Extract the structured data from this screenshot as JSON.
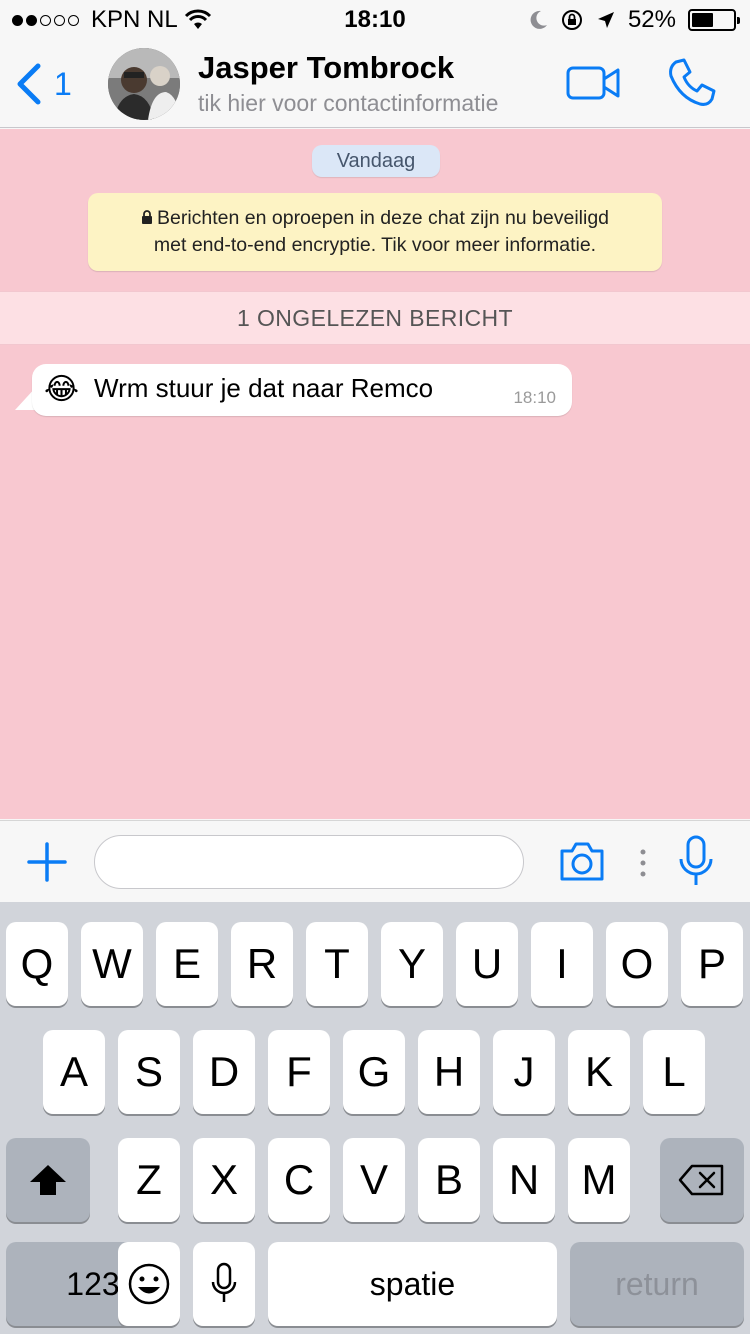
{
  "status_bar": {
    "carrier": "KPN NL",
    "time": "18:10",
    "battery_percent": "52%",
    "battery_level": 0.52,
    "signal_bars": 2,
    "icons": [
      "wifi-icon",
      "moon-icon",
      "orientation-lock-icon",
      "location-icon"
    ]
  },
  "header": {
    "back_count": "1",
    "contact_name": "Jasper Tombrock",
    "contact_subtitle": "tik hier voor contactinformatie",
    "accent_color": "#0a7cf5"
  },
  "chat": {
    "background_color": "#f8c8d0",
    "date_label": "Vandaag",
    "encryption_line1": "Berichten en oproepen in deze chat zijn nu beveiligd",
    "encryption_line2": "met end-to-end encryptie. Tik voor meer informatie.",
    "unread_label": "1 ONGELEZEN BERICHT",
    "messages": [
      {
        "emoji": "😂",
        "text": "Wrm stuur je dat naar Remco",
        "time": "18:10",
        "direction": "incoming"
      }
    ]
  },
  "input": {
    "value": "",
    "placeholder": ""
  },
  "keyboard": {
    "row1": [
      "Q",
      "W",
      "E",
      "R",
      "T",
      "Y",
      "U",
      "I",
      "O",
      "P"
    ],
    "row2": [
      "A",
      "S",
      "D",
      "F",
      "G",
      "H",
      "J",
      "K",
      "L"
    ],
    "row3": [
      "Z",
      "X",
      "C",
      "V",
      "B",
      "N",
      "M"
    ],
    "numbers_key": "123",
    "space_key": "spatie",
    "return_key": "return"
  }
}
